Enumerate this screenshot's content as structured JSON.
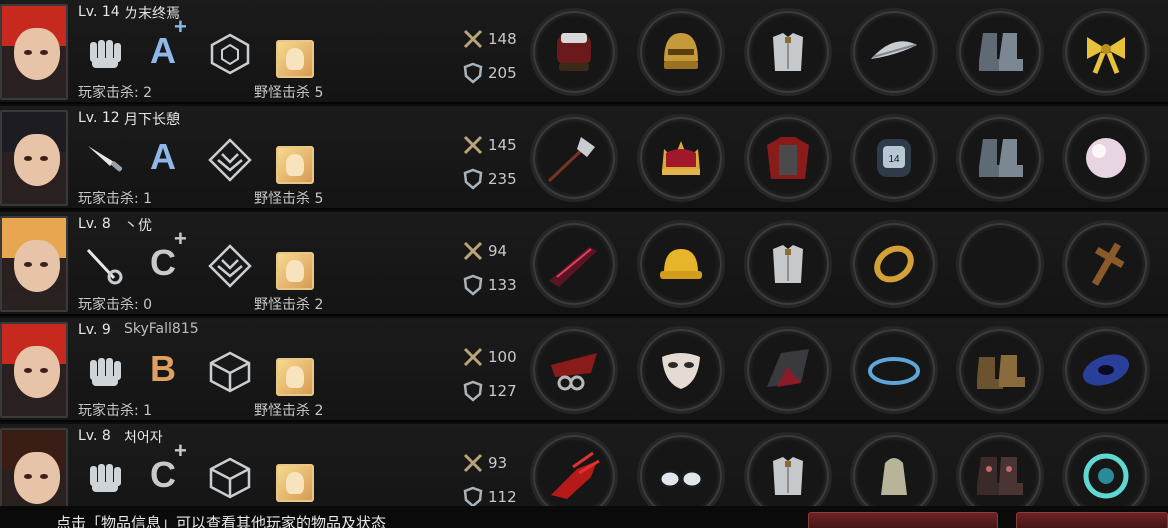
{
  "players": [
    {
      "level": "Lv. 14",
      "name": "ㄌ末终焉",
      "class_icon": "fist-icon",
      "grade": "A",
      "grade_plus": "+",
      "emblem": "hexagon-emblem-icon",
      "player_kills": "玩家击杀: 2",
      "monster_kills": "野怪击杀 5",
      "attack": "148",
      "defense": "205",
      "hair_color": "#c8291e",
      "equipment": [
        "gauntlet-icon",
        "golden-helmet-icon",
        "silver-armor-icon",
        "feather-bracer-icon",
        "steel-boots-icon",
        "gold-ribbon-icon"
      ]
    },
    {
      "level": "Lv. 12",
      "name": "月下长憩",
      "class_icon": "knife-icon",
      "grade": "A",
      "grade_plus": "",
      "emblem": "diamond-emblem-icon",
      "player_kills": "玩家击杀: 1",
      "monster_kills": "野怪击杀 5",
      "attack": "145",
      "defense": "235",
      "hair_color": "#1c1c22",
      "equipment": [
        "halberd-icon",
        "royal-crown-icon",
        "red-cape-armor-icon",
        "wristwatch-icon",
        "steel-boots-icon",
        "pearl-icon"
      ]
    },
    {
      "level": "Lv. 8",
      "name": "丶优",
      "class_icon": "rapier-icon",
      "grade": "C",
      "grade_plus": "+",
      "emblem": "diamond-emblem-icon",
      "player_kills": "玩家击杀: 0",
      "monster_kills": "野怪击杀 2",
      "attack": "94",
      "defense": "133",
      "hair_color": "#e8a650",
      "equipment": [
        "dark-sword-icon",
        "hard-hat-icon",
        "silver-armor-icon",
        "gold-bracelet-icon",
        "empty-slot",
        "wooden-cross-icon"
      ]
    },
    {
      "level": "Lv. 9",
      "name": "SkyFall815",
      "class_icon": "fist-icon",
      "grade": "B",
      "grade_plus": "",
      "emblem": "cube-emblem-icon",
      "player_kills": "玩家击杀: 1",
      "monster_kills": "野怪击杀 2",
      "attack": "100",
      "defense": "127",
      "hair_color": "#c8291e",
      "equipment": [
        "winged-knuckle-icon",
        "white-mask-icon",
        "dark-coat-icon",
        "blue-bracelet-icon",
        "leather-boots-icon",
        "galaxy-icon"
      ]
    },
    {
      "level": "Lv. 8",
      "name": "처어자",
      "class_icon": "fist-icon",
      "grade": "C",
      "grade_plus": "+",
      "emblem": "cube-emblem-icon",
      "player_kills": "",
      "monster_kills": "",
      "attack": "93",
      "defense": "112",
      "hair_color": "#3a1d14",
      "equipment": [
        "red-claw-icon",
        "glasses-icon",
        "silver-armor-icon",
        "silver-thimble-icon",
        "floral-boots-icon",
        "cyan-orb-icon"
      ]
    }
  ],
  "footer": {
    "hint": "点击「物品信息」可以查看其他玩家的物品及状态"
  },
  "colors": {
    "grade": "#c9c9c9",
    "grade_b": "#e0a060",
    "grade_a_blue": "#8fb7e8"
  }
}
